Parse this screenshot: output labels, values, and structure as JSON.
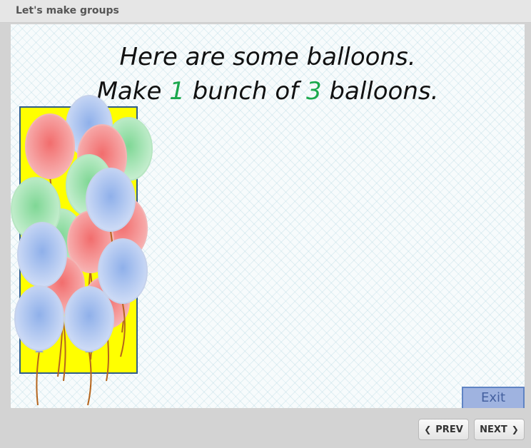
{
  "window": {
    "title": "Let's make groups"
  },
  "instruction": {
    "line1": "Here are some balloons.",
    "line2_pre": "Make ",
    "line2_num1": "1",
    "line2_mid": " bunch of ",
    "line2_num2": "3",
    "line2_post": " balloons."
  },
  "colors": {
    "accent_number": "#1aa84c",
    "box_fill": "#ffff00",
    "box_border": "#2f5d8a",
    "red": "#f28a8a",
    "green": "#9fe0ab",
    "blue": "#a9c1ee"
  },
  "exit_label": "Exit",
  "nav": {
    "prev_label": "PREV",
    "next_label": "NEXT",
    "prev_icon": "chevron-left-icon",
    "next_icon": "chevron-right-icon"
  }
}
